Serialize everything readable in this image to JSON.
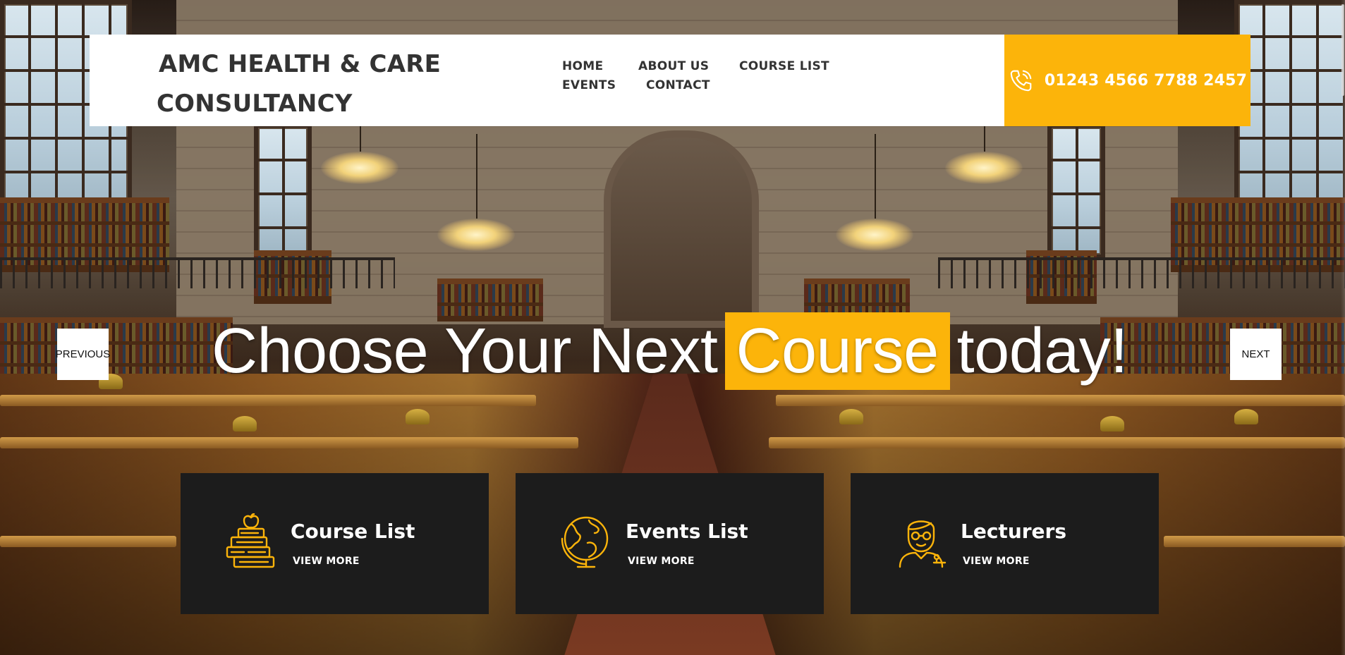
{
  "brand": {
    "name_line1": "AMC HEALTH & CARE",
    "name_line2": "CONSULTANCY"
  },
  "nav": {
    "items": [
      {
        "label": "HOME"
      },
      {
        "label": "ABOUT US"
      },
      {
        "label": "COURSE LIST"
      },
      {
        "label": "EVENTS"
      },
      {
        "label": "CONTACT"
      }
    ]
  },
  "contact": {
    "phone": "01243 4566 7788 2457",
    "icon": "phone-icon"
  },
  "hero": {
    "title_before": "Choose Your Next",
    "title_highlight": "Course",
    "title_after": "today!",
    "prev_label": "PREVIOUS",
    "next_label": "NEXT"
  },
  "cards": [
    {
      "title": "Course List",
      "link": "VIEW MORE",
      "icon": "books-apple-icon"
    },
    {
      "title": "Events List",
      "link": "VIEW MORE",
      "icon": "globe-icon"
    },
    {
      "title": "Lecturers",
      "link": "VIEW MORE",
      "icon": "lecturer-icon"
    }
  ],
  "colors": {
    "accent": "#fcb40a",
    "header_bg": "#ffffff",
    "card_bg": "#1c1c1c",
    "text_dark": "#333333",
    "text_light": "#ffffff"
  }
}
